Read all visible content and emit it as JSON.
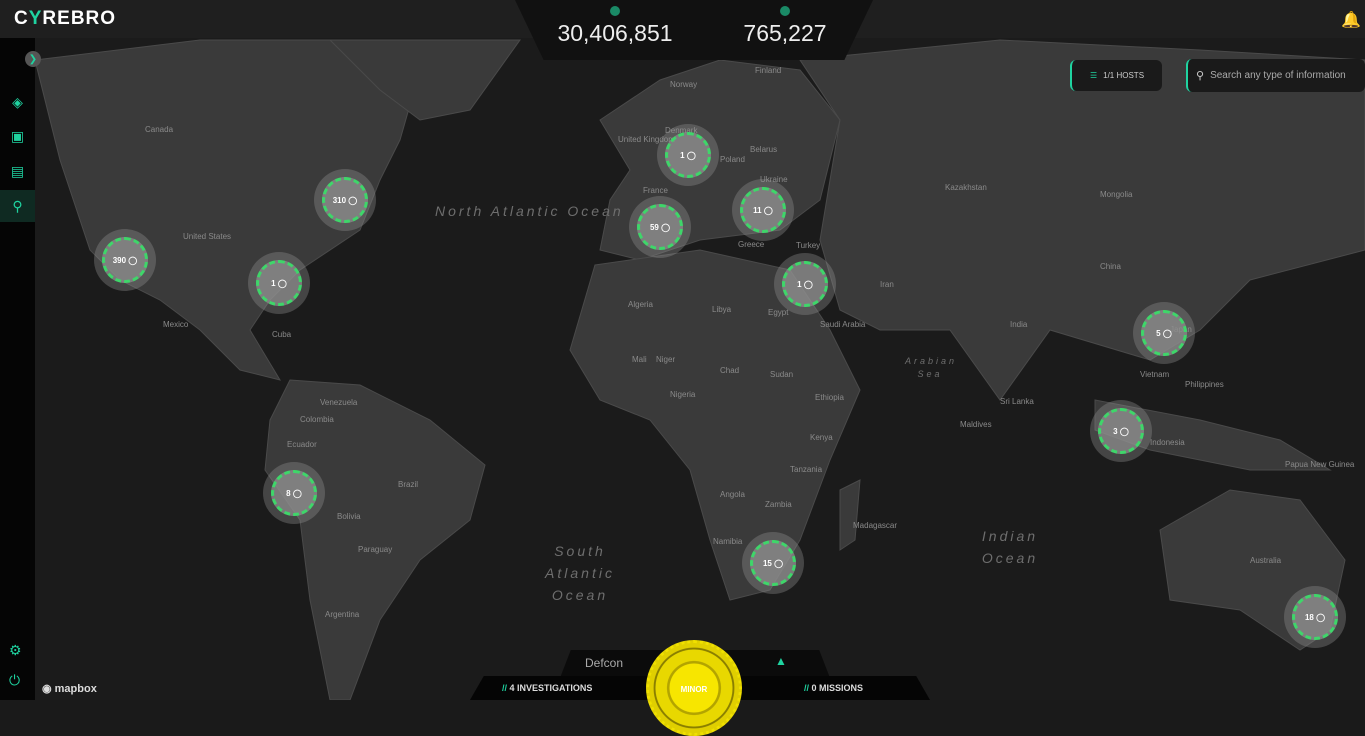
{
  "app": {
    "logo_prefix": "C",
    "logo_mark": "Y",
    "logo_suffix": "REBRO"
  },
  "stats": [
    {
      "icon": "events-icon",
      "value": "30,406,851"
    },
    {
      "icon": "alerts-icon",
      "value": "765,227"
    }
  ],
  "toolbar": {
    "hosts_label": "1/1 HOSTS",
    "search_placeholder": "Search any type of information"
  },
  "sidebar": {
    "items": [
      "dashboard",
      "cases",
      "reports",
      "map"
    ],
    "active": "map"
  },
  "markers": [
    {
      "label": "390",
      "name": "marker-west-us"
    },
    {
      "label": "310",
      "name": "marker-east-us"
    },
    {
      "label": "1",
      "name": "marker-south-us"
    },
    {
      "label": "1",
      "name": "marker-denmark"
    },
    {
      "label": "59",
      "name": "marker-spain"
    },
    {
      "label": "11",
      "name": "marker-balkans"
    },
    {
      "label": "1",
      "name": "marker-israel"
    },
    {
      "label": "5",
      "name": "marker-taiwan"
    },
    {
      "label": "3",
      "name": "marker-malaysia"
    },
    {
      "label": "8",
      "name": "marker-peru"
    },
    {
      "label": "15",
      "name": "marker-south-africa"
    },
    {
      "label": "18",
      "name": "marker-australia"
    }
  ],
  "map_labels": {
    "oceans": [
      "North Atlantic Ocean",
      "South Atlantic Ocean",
      "Indian Ocean",
      "Arabian Sea"
    ],
    "countries": [
      "Canada",
      "United States",
      "Mexico",
      "Cuba",
      "Venezuela",
      "Colombia",
      "Ecuador",
      "Brazil",
      "Bolivia",
      "Paraguay",
      "Argentina",
      "Norway",
      "Finland",
      "United Kingdom",
      "Denmark",
      "Poland",
      "Belarus",
      "Ukraine",
      "France",
      "Greece",
      "Turkey",
      "Algeria",
      "Libya",
      "Egypt",
      "Mali",
      "Niger",
      "Chad",
      "Sudan",
      "Nigeria",
      "Ethiopia",
      "Kenya",
      "Tanzania",
      "Angola",
      "Zambia",
      "Namibia",
      "Madagascar",
      "Saudi Arabia",
      "Iran",
      "Kazakhstan",
      "Mongolia",
      "China",
      "India",
      "Sri Lanka",
      "Maldives",
      "Vietnam",
      "Philippines",
      "Indonesia",
      "Papua New Guinea",
      "Australia",
      "Japan"
    ]
  },
  "bottom": {
    "defcon_label": "Defcon",
    "level": "MINOR",
    "investigations": "4 INVESTIGATIONS",
    "missions": "0 MISSIONS"
  },
  "attribution": "mapbox"
}
